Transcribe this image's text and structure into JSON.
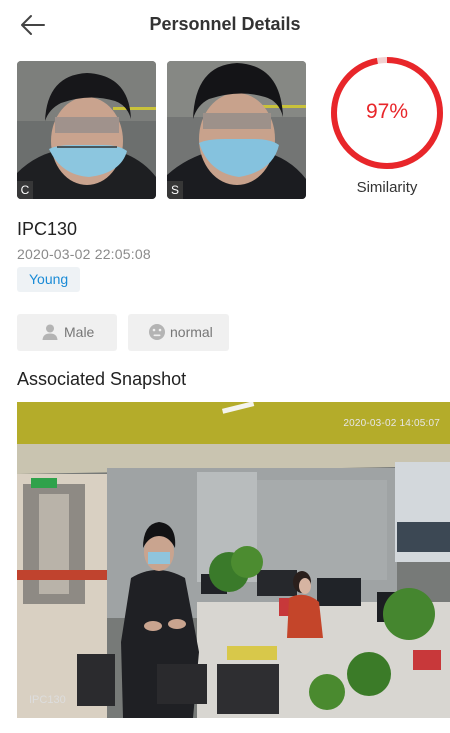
{
  "header": {
    "title": "Personnel Details",
    "back_icon": "arrow-left-icon"
  },
  "faces": [
    {
      "tag": "C"
    },
    {
      "tag": "S"
    }
  ],
  "similarity": {
    "percent": 97,
    "label_value": "97%",
    "label": "Similarity",
    "color": "#e8262a"
  },
  "record": {
    "device": "IPC130",
    "timestamp": "2020-03-02  22:05:08",
    "age_tag": "Young"
  },
  "attributes": [
    {
      "icon": "person-icon",
      "label": "Male"
    },
    {
      "icon": "face-neutral-icon",
      "label": "normal"
    }
  ],
  "section": {
    "title": "Associated Snapshot"
  },
  "snapshot": {
    "timestamp": "2020-03-02 14:05:07",
    "camera_label": "IPC130"
  },
  "colors": {
    "accent": "#e8262a",
    "tag_text": "#1a8bd6",
    "tag_bg": "#eef2f5",
    "chip_bg": "#f0f0f0"
  }
}
